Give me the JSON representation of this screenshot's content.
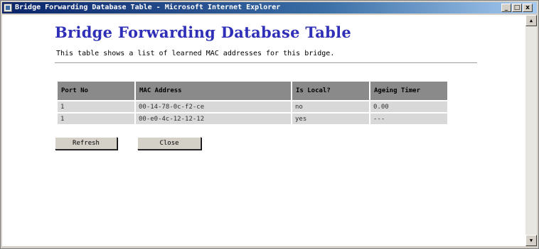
{
  "window": {
    "title": "Bridge Forwarding Database Table - Microsoft Internet Explorer",
    "minimize_glyph": "_",
    "maximize_glyph": "□",
    "close_glyph": "x"
  },
  "page": {
    "title": "Bridge Forwarding Database Table",
    "intro": "This table shows a list of learned MAC addresses for this bridge."
  },
  "table": {
    "headers": {
      "port_no": "Port No",
      "mac_address": "MAC Address",
      "is_local": "Is Local?",
      "ageing_timer": "Ageing Timer"
    },
    "rows": [
      {
        "port_no": "1",
        "mac_address": "00-14-78-0c-f2-ce",
        "is_local": "no",
        "ageing_timer": "0.00"
      },
      {
        "port_no": "1",
        "mac_address": "00-e0-4c-12-12-12",
        "is_local": "yes",
        "ageing_timer": "---"
      }
    ]
  },
  "buttons": {
    "refresh_label": "Refresh",
    "close_label": "Close"
  },
  "scrollbar": {
    "up_glyph": "▲",
    "down_glyph": "▼"
  },
  "colors": {
    "title_color": "#2f2fb7",
    "header_bg": "#8a8a8a",
    "cell_bg": "#d8d8d8"
  }
}
